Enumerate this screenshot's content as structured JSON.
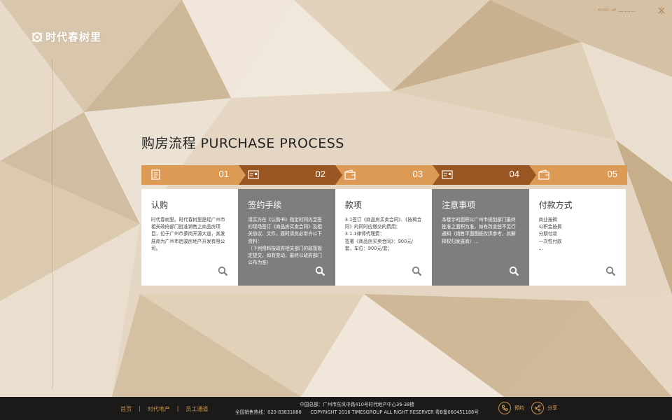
{
  "brand": {
    "logo_text": "时代春树里"
  },
  "music": {
    "label": "MUSIC: off"
  },
  "section": {
    "title": "购房流程  PURCHASE PROCESS"
  },
  "steps": [
    {
      "num": "01",
      "icon": "document-icon",
      "title": "认购",
      "body": "时代春树里。时代春树里是经广州市相关政府部门批准销售之商品房项目，位于广州市萝岗开源大道，其发展商为广州市启骏房地产开发有限公司。",
      "style": "white"
    },
    {
      "num": "02",
      "icon": "card-icon",
      "title": "签约手续",
      "body": "请买方在《认购书》指定时间内至签约现场签订《商品房买卖合同》及相关协议、文件，届时请务必带齐以下资料：\n（下列资料按政府相关部门的政策规定提交，如有变动，最终以政府部门公布为准）",
      "style": "grey"
    },
    {
      "num": "03",
      "icon": "wallet-icon",
      "title": "款项",
      "body": "3.1签订《商品房买卖合同》、《按揭合同》的同时应缴交的费用：\n3.1.1律师代理费：\n签署《商品房买卖合同》：900元/套，车位：900元/套；",
      "style": "white"
    },
    {
      "num": "04",
      "icon": "card-icon",
      "title": "注意事项",
      "body": "本楼宇的面积以广州市规划部门最终批准之面积为准，如有改变恕不另行通知（销售平面图纸仅供参考，其解释权归发展商）...",
      "style": "grey"
    },
    {
      "num": "05",
      "icon": "wallet-icon",
      "title": "付款方式",
      "body": "商业按揭\n公积金按揭\n分期付款\n一次性付款\n...",
      "style": "white"
    }
  ],
  "footer": {
    "nav": [
      "首页",
      "时代地产",
      "员工通道"
    ],
    "address": "中国总部：广州市东风中路410号时代地产中心36-38楼",
    "hotline": "全国销售热线：020-83831888      COPYRIGHT 2016 TIMESGROUP ALL RIGHT RESERVER 粤B备060451188号",
    "reserve_label": "预约",
    "share_label": "分享"
  },
  "colors": {
    "accent_light": "#dd9a55",
    "accent_dark": "#9a5622",
    "card_grey": "#7f7e7c",
    "footer_bg": "#1c1a18",
    "footer_link": "#c8904d"
  }
}
